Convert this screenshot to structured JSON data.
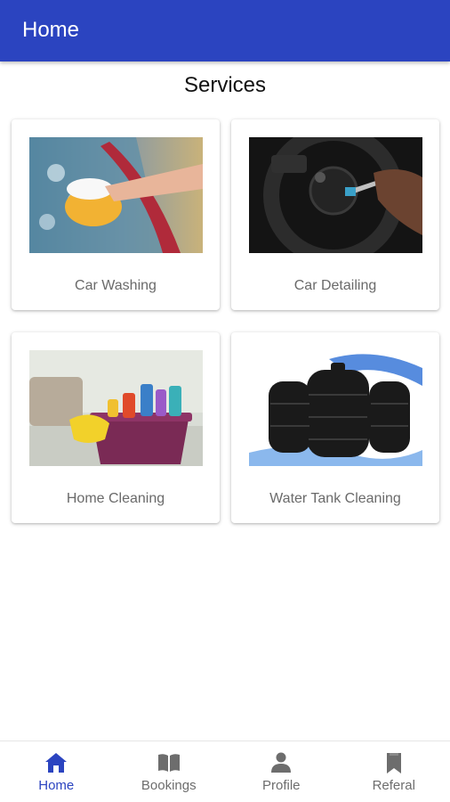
{
  "header": {
    "title": "Home"
  },
  "services": {
    "title": "Services",
    "items": [
      {
        "label": "Car Washing",
        "image": "car-washing-photo"
      },
      {
        "label": "Car Detailing",
        "image": "car-detailing-photo"
      },
      {
        "label": "Home Cleaning",
        "image": "home-cleaning-photo"
      },
      {
        "label": "Water Tank Cleaning",
        "image": "water-tank-photo"
      }
    ]
  },
  "bottom_nav": {
    "active": "Home",
    "items": [
      {
        "label": "Home",
        "icon": "home-icon"
      },
      {
        "label": "Bookings",
        "icon": "book-icon"
      },
      {
        "label": "Profile",
        "icon": "person-icon"
      },
      {
        "label": "Referal",
        "icon": "bookmark-icon"
      }
    ]
  },
  "colors": {
    "primary": "#2b44c0",
    "label_gray": "#6a6a6a",
    "nav_inactive": "#6d6d6d"
  }
}
